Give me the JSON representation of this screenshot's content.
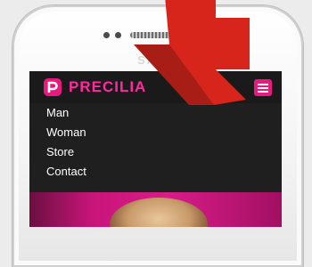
{
  "device": {
    "brand_text": "SA"
  },
  "header": {
    "logo_text": "PRECILIA"
  },
  "menu": {
    "items": [
      {
        "label": "Man"
      },
      {
        "label": "Woman"
      },
      {
        "label": "Store"
      },
      {
        "label": "Contact"
      }
    ]
  },
  "colors": {
    "accent": "#e8197f",
    "menu_bg": "#1f1f1f",
    "arrow": "#d8251c"
  },
  "icons": [
    "logo-p-icon",
    "cart-icon",
    "hamburger-icon",
    "arrow-icon"
  ]
}
